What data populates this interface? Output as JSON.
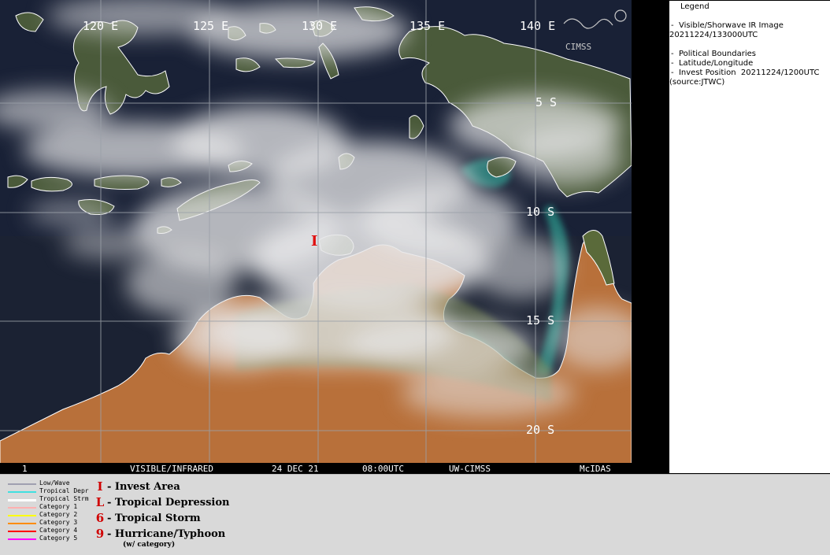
{
  "map": {
    "longitude_labels": [
      "120 E",
      "125 E",
      "130 E",
      "135 E",
      "140 E"
    ],
    "latitude_labels": [
      "5 S",
      "10 S",
      "15 S",
      "20 S"
    ],
    "invest_marker": "I",
    "watermark": "CIMSS",
    "bottom_strip": {
      "frame": "1",
      "product": "VISIBLE/INFRARED",
      "date": "24 DEC 21",
      "time": "08:00UTC",
      "source": "UW-CIMSS",
      "software": "McIDAS"
    },
    "colors": {
      "ocean": "#1b2233",
      "land_north": "#4a5a3a",
      "land_australia": "#b8703a",
      "cloud": "#e8e8ea",
      "shallow_water": "#2a9b8e",
      "coastline": "#ffffff",
      "gridline": "#9aa0a8",
      "invest": "#e01010"
    }
  },
  "legend": {
    "title": "Legend",
    "image_line1": "Visible/Shorwave IR Image",
    "image_line2": "20211224/133000UTC",
    "boundaries": "Political Boundaries",
    "latlon": "Latitude/Longitude",
    "invest_position": "Invest Position  20211224/1200UTC",
    "source": "(source:JTWC)"
  },
  "track_legend": {
    "lines": [
      {
        "label": "Low/Wave",
        "color": "#a0a0b0"
      },
      {
        "label": "Tropical Depr",
        "color": "#40e0e0"
      },
      {
        "label": "Tropical Strm",
        "color": "#ffffff"
      },
      {
        "label": "Category 1",
        "color": "#ffb0b0"
      },
      {
        "label": "Category 2",
        "color": "#ffff00"
      },
      {
        "label": "Category 3",
        "color": "#ff8c00"
      },
      {
        "label": "Category 4",
        "color": "#ff0000"
      },
      {
        "label": "Category 5",
        "color": "#ff00ff"
      }
    ],
    "symbols": [
      {
        "glyph": "I",
        "label": "- Invest Area"
      },
      {
        "glyph": "L",
        "label": "- Tropical Depression"
      },
      {
        "glyph": "6",
        "label": "- Tropical Storm"
      },
      {
        "glyph": "9",
        "label": "- Hurricane/Typhoon"
      }
    ],
    "category_note": "(w/ category)"
  }
}
